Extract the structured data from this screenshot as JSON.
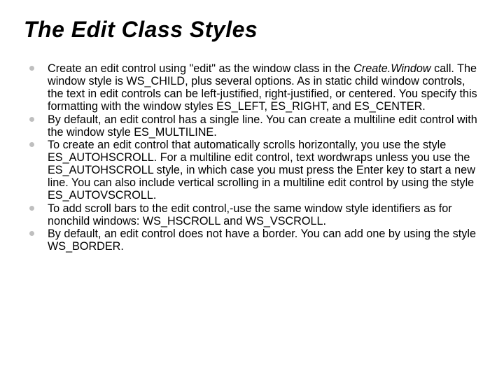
{
  "title": "The Edit Class Styles",
  "bullets": [
    {
      "pre": "Create an edit control using \"edit\" as the window class in the ",
      "em": "Create.Window",
      "post": " call. The window style is WS_CHILD, plus several options. As in static child window controls, the text in edit controls can be left-justified, right-justified, or centered. You specify this formatting with the window styles ES_LEFT, ES_RIGHT, and ES_CENTER."
    },
    {
      "pre": "By default, an edit control has a single line. You can create a multiline edit control with the window style ES_MULTILINE.",
      "em": "",
      "post": ""
    },
    {
      "pre": "To create an edit control that automatically scrolls horizontally, you use the style ES_AUTOHSCROLL. For a multiline edit control, text wordwraps unless you use the ES_AUTOHSCROLL style, in which case you must press the Enter key to start a new line. You can also include vertical scrolling in a multiline edit control by using the style ES_AUTOVSCROLL.",
      "em": "",
      "post": ""
    },
    {
      "pre": "To add scroll bars to the edit control,-use the same window style identifiers as for nonchild windows: WS_HSCROLL and WS_VSCROLL.",
      "em": "",
      "post": ""
    },
    {
      "pre": "By default, an edit control does not have a border. You can add one by using the style WS_BORDER.",
      "em": "",
      "post": ""
    }
  ]
}
